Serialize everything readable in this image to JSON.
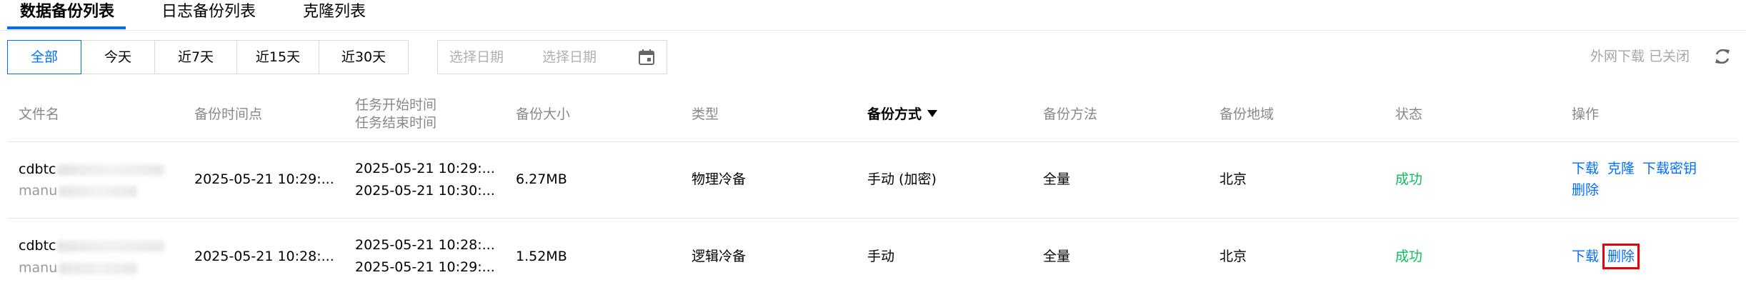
{
  "tabs": [
    {
      "label": "数据备份列表",
      "active": true
    },
    {
      "label": "日志备份列表"
    },
    {
      "label": "克隆列表"
    }
  ],
  "range_filter": [
    "全部",
    "今天",
    "近7天",
    "近15天",
    "近30天"
  ],
  "date_picker": {
    "start_placeholder": "选择日期",
    "end_placeholder": "选择日期",
    "icon": "calendar-icon"
  },
  "external_download": "外网下载 已关闭",
  "refresh_icon": "refresh-icon",
  "columns": {
    "file": "文件名",
    "backup_time": "备份时间点",
    "task_start": "任务开始时间",
    "task_end": "任务结束时间",
    "size": "备份大小",
    "type": "类型",
    "mode": "备份方式",
    "method": "备份方法",
    "region": "备份地域",
    "status": "状态",
    "ops": "操作"
  },
  "rows": [
    {
      "file_main": "cdbtc",
      "file_sub": "manu",
      "backup_time": "2025-05-21 10:29:...",
      "task_start": "2025-05-21 10:29:...",
      "task_end": "2025-05-21 10:30:...",
      "size": "6.27MB",
      "type": "物理冷备",
      "mode": "手动 (加密)",
      "method": "全量",
      "region": "北京",
      "status": "成功",
      "ops": {
        "download": "下载",
        "clone": "克隆",
        "download_key": "下载密钥",
        "delete": "删除"
      }
    },
    {
      "file_main": "cdbtc",
      "file_sub": "manu",
      "backup_time": "2025-05-21 10:28:...",
      "task_start": "2025-05-21 10:28:...",
      "task_end": "2025-05-21 10:29:...",
      "size": "1.52MB",
      "type": "逻辑冷备",
      "mode": "手动",
      "method": "全量",
      "region": "北京",
      "status": "成功",
      "ops": {
        "download": "下载",
        "delete": "删除"
      }
    }
  ],
  "colors": {
    "accent": "#006eff",
    "success": "#0abf5b",
    "highlight": "#e8000b"
  }
}
